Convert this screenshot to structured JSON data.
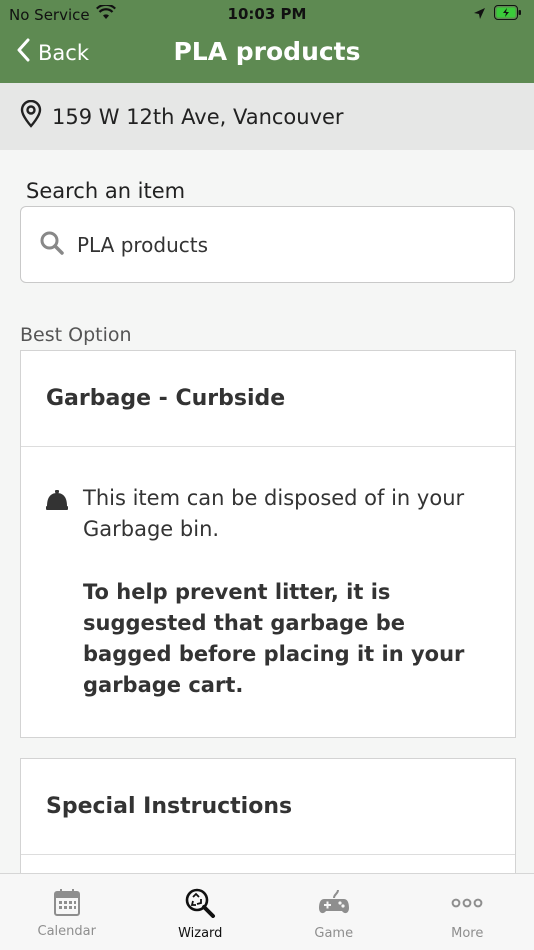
{
  "status": {
    "carrier": "No Service",
    "time": "10:03 PM"
  },
  "nav": {
    "back_label": "Back",
    "title": "PLA products"
  },
  "address": {
    "text": "159 W 12th Ave, Vancouver"
  },
  "search": {
    "label": "Search an item",
    "value": "PLA products"
  },
  "best_option": {
    "label": "Best Option",
    "heading": "Garbage  -  Curbside",
    "description": "This item can be disposed of in your Garbage bin.",
    "note": "To help prevent litter, it is suggested that garbage be bagged before placing it in your garbage cart."
  },
  "special": {
    "heading": "Special Instructions"
  },
  "tabs": [
    {
      "label": "Calendar",
      "icon": "calendar-icon"
    },
    {
      "label": "Wizard",
      "icon": "wizard-icon",
      "active": true
    },
    {
      "label": "Game",
      "icon": "gamepad-icon"
    },
    {
      "label": "More",
      "icon": "more-icon"
    }
  ],
  "colors": {
    "header": "#5e8a52",
    "address_bg": "#e6e7e6"
  }
}
